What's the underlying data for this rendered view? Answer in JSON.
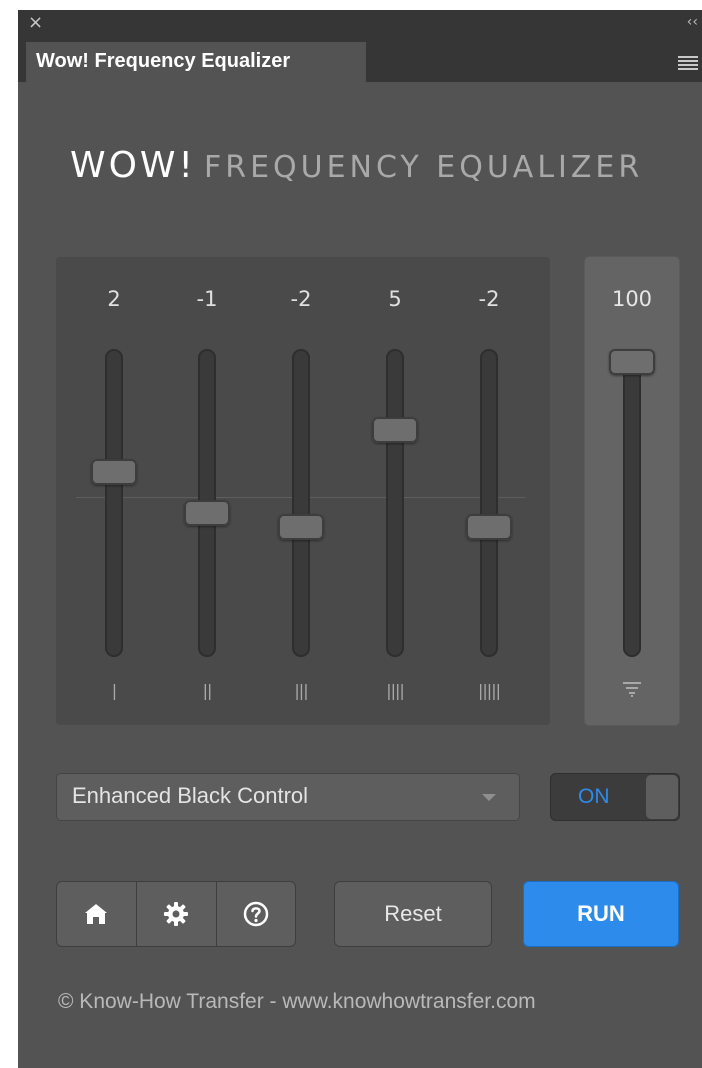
{
  "window": {
    "close_glyph": "×",
    "collapse_glyph": "‹‹",
    "tab_title": "Wow! Frequency Equalizer"
  },
  "logo": {
    "wow": "WOW!",
    "rest": "FREQUENCY EQUALIZER"
  },
  "equalizer": {
    "bands": [
      {
        "value": "2",
        "label": "|"
      },
      {
        "value": "-1",
        "label": "||"
      },
      {
        "value": "-2",
        "label": "|||"
      },
      {
        "value": "5",
        "label": "||||"
      },
      {
        "value": "-2",
        "label": "|||||"
      }
    ],
    "master": {
      "value": "100",
      "icon": "funnel-lines-icon"
    }
  },
  "preset": {
    "selected": "Enhanced Black Control"
  },
  "toggle": {
    "label": "ON",
    "state": "on"
  },
  "toolbar": {
    "icons": [
      "home-icon",
      "gear-icon",
      "help-icon"
    ],
    "reset_label": "Reset",
    "run_label": "RUN"
  },
  "footer": {
    "text": "© Know-How Transfer - www.knowhowtransfer.com"
  },
  "colors": {
    "accent": "#2d8ceb",
    "panel_bg": "#535353",
    "titlebar_bg": "#363636"
  }
}
